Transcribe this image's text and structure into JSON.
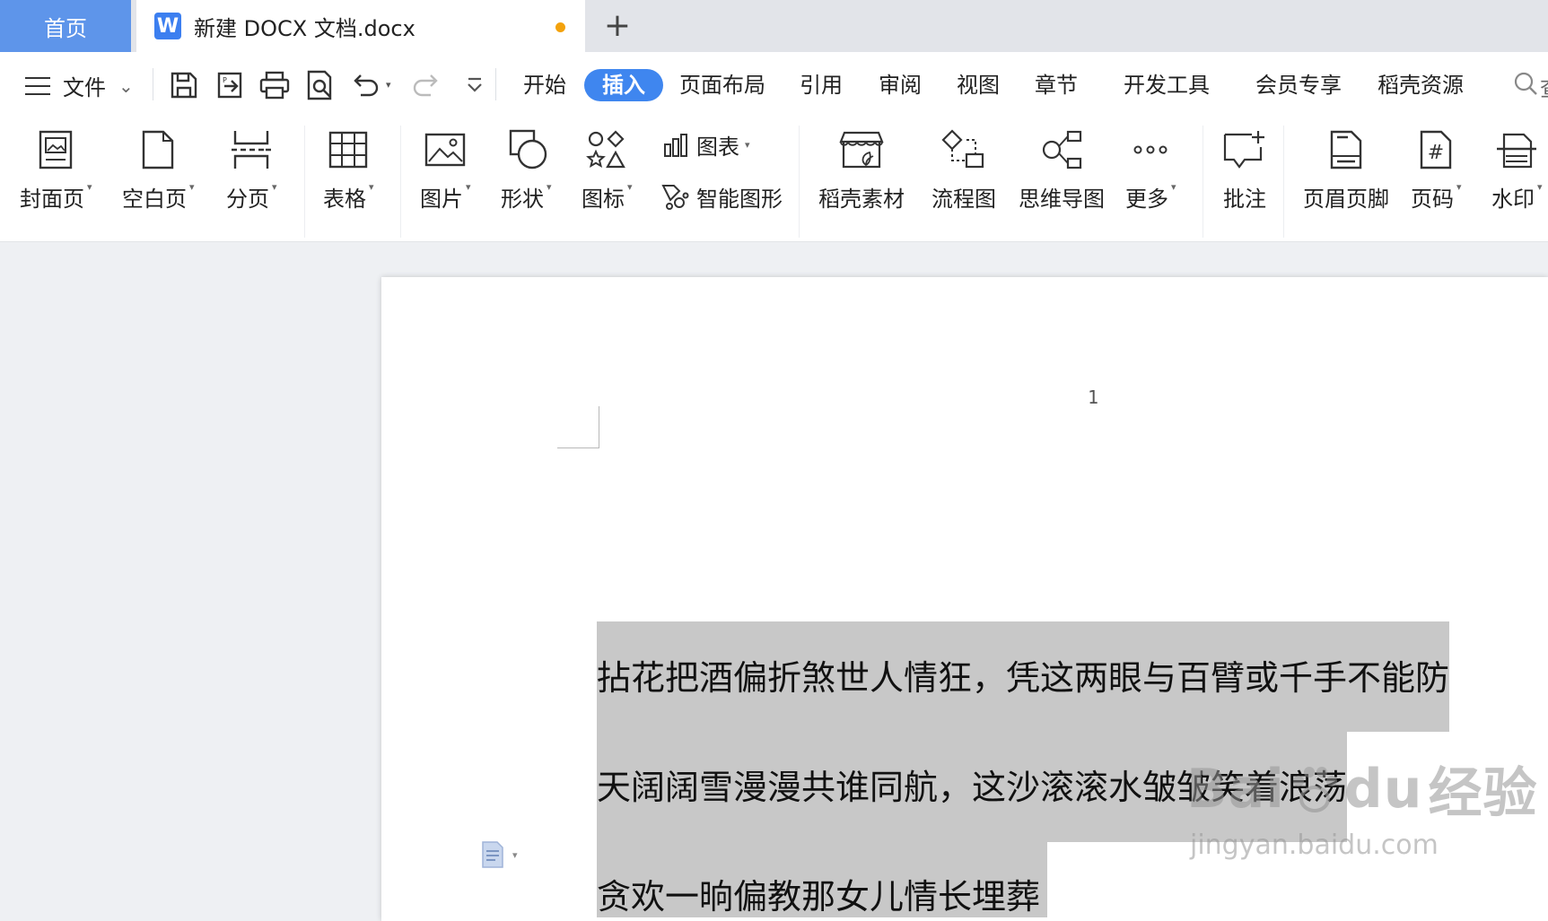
{
  "tabs": {
    "home_label": "首页",
    "doc_title": "新建 DOCX 文档.docx",
    "doc_app_letter": "W",
    "modified_dot_color": "#f3a20c",
    "new_tab_symbol": "+"
  },
  "menu": {
    "file_label": "文件",
    "tabs": [
      "开始",
      "插入",
      "页面布局",
      "引用",
      "审阅",
      "视图",
      "章节",
      "开发工具",
      "会员专享",
      "稻壳资源"
    ],
    "active_tab": "插入",
    "search_partial": "查"
  },
  "quick_access": [
    "save-icon",
    "export-icon",
    "print-icon",
    "print-preview-icon",
    "undo-icon",
    "redo-icon",
    "customize-icon"
  ],
  "ribbon": {
    "cover_page": "封面页",
    "blank_page": "空白页",
    "page_break": "分页",
    "table": "表格",
    "picture": "图片",
    "shape": "形状",
    "icon": "图标",
    "chart": "图表",
    "smart_art": "智能图形",
    "docer_material": "稻壳素材",
    "flowchart": "流程图",
    "mind_map": "思维导图",
    "more": "更多",
    "comment": "批注",
    "header_footer": "页眉页脚",
    "page_number": "页码",
    "watermark": "水印"
  },
  "document": {
    "page_number": "1",
    "lines": [
      "拈花把酒偏折煞世人情狂，凭这两眼与百臂或千手不能防",
      "天阔阔雪漫漫共谁同航，这沙滚滚水皱皱笑着浪荡",
      "贪欢一晌偏教那女儿情长埋葬"
    ],
    "selection_color": "#c8c8c8"
  },
  "watermark": {
    "brand": "Bai",
    "brand_tail": "du",
    "brand_cn": "经验",
    "url": "jingyan.baidu.com"
  },
  "colors": {
    "accent": "#3f86ef",
    "home_tab": "#5e95ea"
  }
}
